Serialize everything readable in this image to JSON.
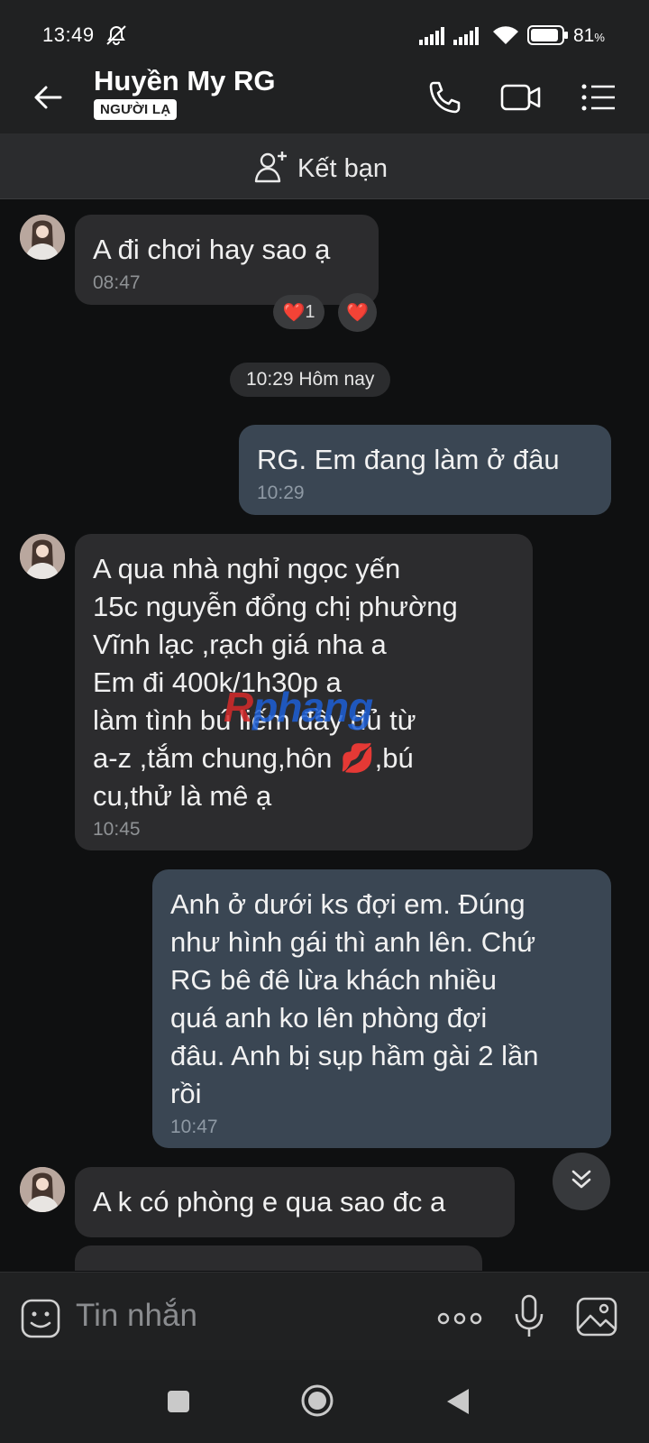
{
  "status_bar": {
    "time": "13:49",
    "battery_percent": "81",
    "battery_unit": "%"
  },
  "header": {
    "contact_name": "Huyền My RG",
    "stranger_badge": "NGƯỜI LẠ"
  },
  "add_friend": {
    "label": "Kết bạn"
  },
  "messages": [
    {
      "direction": "in",
      "text": "A đi chơi hay sao ạ",
      "time": "08:47"
    },
    {
      "direction": "out",
      "text": "RG. Em đang làm ở đâu",
      "time": "10:29"
    },
    {
      "direction": "in",
      "text": " A qua nhà nghỉ ngọc yến\n15c nguyễn đổng chị phường\nVĩnh lạc ,rạch giá nha a\nEm đi 400k/1h30p a\nlàm tình bú liếm đầy đủ từ\na-z ,tắm chung,hôn 💋,bú\ncu,thử là mê ạ",
      "time": "10:45"
    },
    {
      "direction": "out",
      "text": "Anh ở dưới ks đợi em. Đúng\nnhư hình gái thì anh lên. Chứ\nRG bê đê lừa khách nhiều\nquá anh ko lên phòng đợi\nđâu. Anh bị sụp hầm gài 2 lần\nrồi",
      "time": "10:47"
    },
    {
      "direction": "in",
      "text": "A k có phòng e qua sao đc a",
      "time": ""
    }
  ],
  "reactions": {
    "heart_count": "1",
    "emoji": "❤️"
  },
  "date_separator": "10:29 Hôm nay",
  "watermark": {
    "part1": "R",
    "part2": "phang"
  },
  "input": {
    "placeholder": "Tin nhắn"
  },
  "colors": {
    "background": "#0f1011",
    "incoming_bubble": "#2c2c2e",
    "outgoing_bubble": "#3a4653",
    "header": "#202122"
  }
}
